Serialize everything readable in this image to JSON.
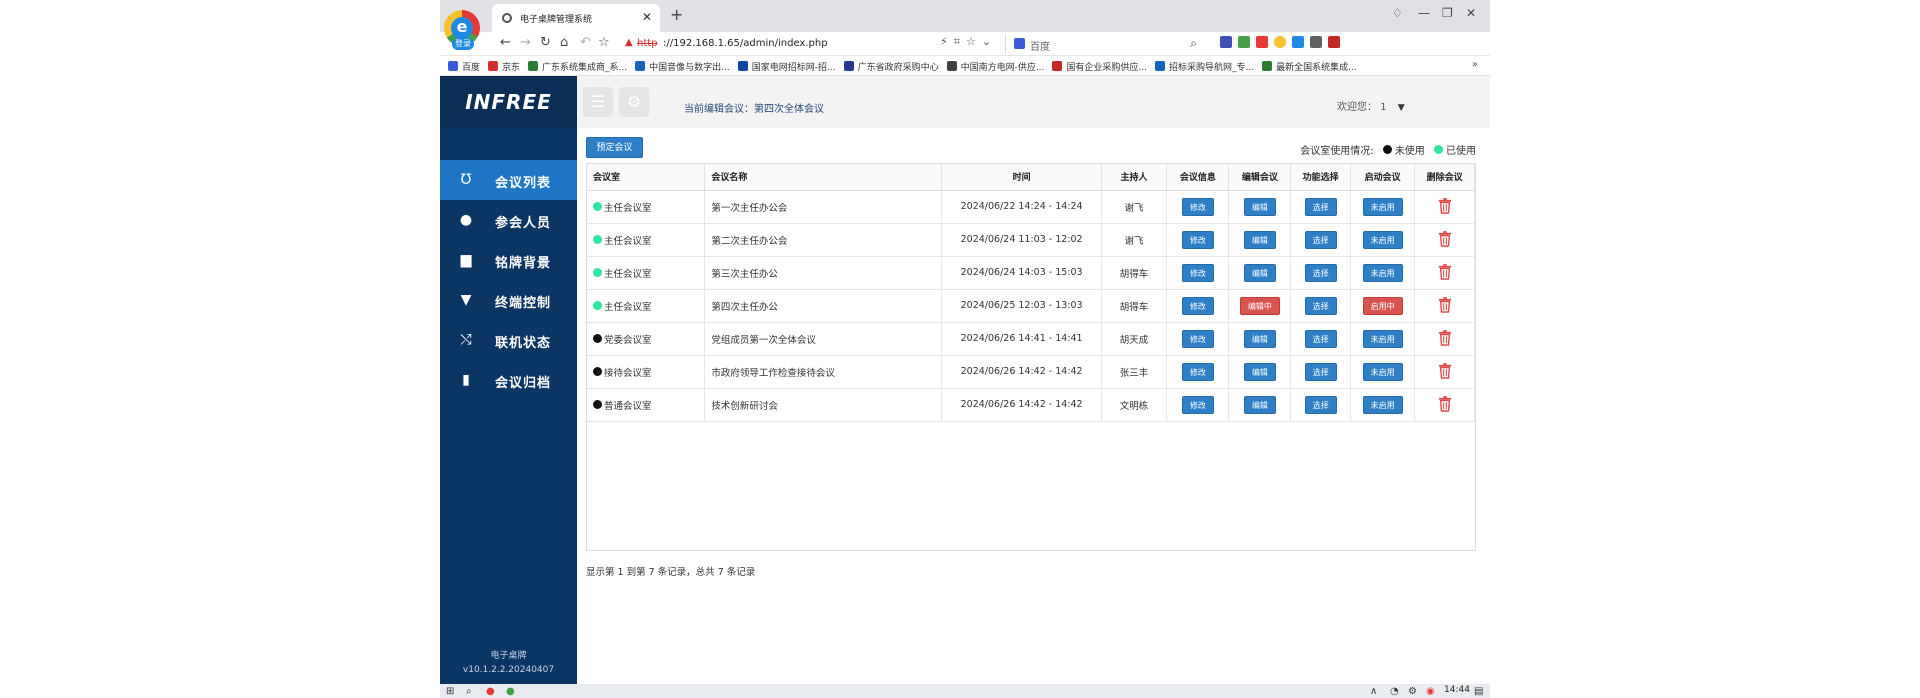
{
  "browser": {
    "tab_title": "电子桌牌管理系统",
    "login_badge": "登录",
    "url_scheme": "http",
    "url_rest": "://192.168.1.65/admin/index.php",
    "search_placeholder": "百度",
    "bookmarks": [
      {
        "label": "百度",
        "color": "#3b5bdb"
      },
      {
        "label": "京东",
        "color": "#d32f2f"
      },
      {
        "label": "广东系统集成商_系...",
        "color": "#2e7d32"
      },
      {
        "label": "中国音像与数字出...",
        "color": "#1565c0"
      },
      {
        "label": "国家电网招标网-招...",
        "color": "#0d47a1"
      },
      {
        "label": "广东省政府采购中心",
        "color": "#283593"
      },
      {
        "label": "中国南方电网-供应...",
        "color": "#424242"
      },
      {
        "label": "国有企业采购供应...",
        "color": "#c62828"
      },
      {
        "label": "招标采购导航网_专...",
        "color": "#1565c0"
      },
      {
        "label": "最新全国系统集成...",
        "color": "#2e7d32"
      }
    ],
    "bookmarks_more": "»"
  },
  "sidebar": {
    "logo": "INFREE",
    "items": [
      {
        "label": "会议列表",
        "icon": "magnet-icon",
        "active": true
      },
      {
        "label": "参会人员",
        "icon": "user-icon",
        "active": false
      },
      {
        "label": "铭牌背景",
        "icon": "easel-icon",
        "active": false
      },
      {
        "label": "终端控制",
        "icon": "filter-icon",
        "active": false
      },
      {
        "label": "联机状态",
        "icon": "shuffle-icon",
        "active": false
      },
      {
        "label": "会议归档",
        "icon": "book-icon",
        "active": false
      }
    ],
    "footer_name": "电子桌牌",
    "footer_version": "v10.1.2.2.20240407"
  },
  "topbar": {
    "current_edit_label": "当前编辑会议：第四次全体会议",
    "welcome_label": "欢迎您：",
    "user_name": "1"
  },
  "toolbar": {
    "book_label": "预定会议",
    "legend_title": "会议室使用情况:",
    "legend_unused": "未使用",
    "legend_used": "已使用",
    "color_unused": "#111111",
    "color_used": "#2ee6a0"
  },
  "table": {
    "headers": [
      "会议室",
      "会议名称",
      "时间",
      "主持人",
      "会议信息",
      "编辑会议",
      "功能选择",
      "启动会议",
      "删除会议"
    ],
    "rows": [
      {
        "status": "used",
        "room": "主任会议室",
        "name": "第一次主任办公会",
        "time": "2024/06/22 14:24 - 14:24",
        "host": "谢飞",
        "info": "修改",
        "edit": "编辑",
        "edit_state": "normal",
        "func": "选择",
        "start": "未启用",
        "start_state": "normal"
      },
      {
        "status": "used",
        "room": "主任会议室",
        "name": "第二次主任办公会",
        "time": "2024/06/24 11:03 - 12:02",
        "host": "谢飞",
        "info": "修改",
        "edit": "编辑",
        "edit_state": "normal",
        "func": "选择",
        "start": "未启用",
        "start_state": "normal"
      },
      {
        "status": "used",
        "room": "主任会议室",
        "name": "第三次主任办公",
        "time": "2024/06/24 14:03 - 15:03",
        "host": "胡得车",
        "info": "修改",
        "edit": "编辑",
        "edit_state": "normal",
        "func": "选择",
        "start": "未启用",
        "start_state": "normal"
      },
      {
        "status": "used",
        "room": "主任会议室",
        "name": "第四次主任办公",
        "time": "2024/06/25 12:03 - 13:03",
        "host": "胡得车",
        "info": "修改",
        "edit": "编辑中",
        "edit_state": "active",
        "func": "选择",
        "start": "启用中",
        "start_state": "active"
      },
      {
        "status": "unused",
        "room": "党委会议室",
        "name": "党组成员第一次全体会议",
        "time": "2024/06/26 14:41 - 14:41",
        "host": "胡天成",
        "info": "修改",
        "edit": "编辑",
        "edit_state": "normal",
        "func": "选择",
        "start": "未启用",
        "start_state": "normal"
      },
      {
        "status": "unused",
        "room": "接待会议室",
        "name": "市政府领导工作检查接待会议",
        "time": "2024/06/26 14:42 - 14:42",
        "host": "张三丰",
        "info": "修改",
        "edit": "编辑",
        "edit_state": "normal",
        "func": "选择",
        "start": "未启用",
        "start_state": "normal"
      },
      {
        "status": "unused",
        "room": "普通会议室",
        "name": "技术创新研讨会",
        "time": "2024/06/26 14:42 - 14:42",
        "host": "文明栋",
        "info": "修改",
        "edit": "编辑",
        "edit_state": "normal",
        "func": "选择",
        "start": "未启用",
        "start_state": "normal"
      }
    ]
  },
  "pager": {
    "summary": "显示第 1 到第 7 条记录，总共 7 条记录"
  },
  "taskbar": {
    "time": "14:44"
  }
}
